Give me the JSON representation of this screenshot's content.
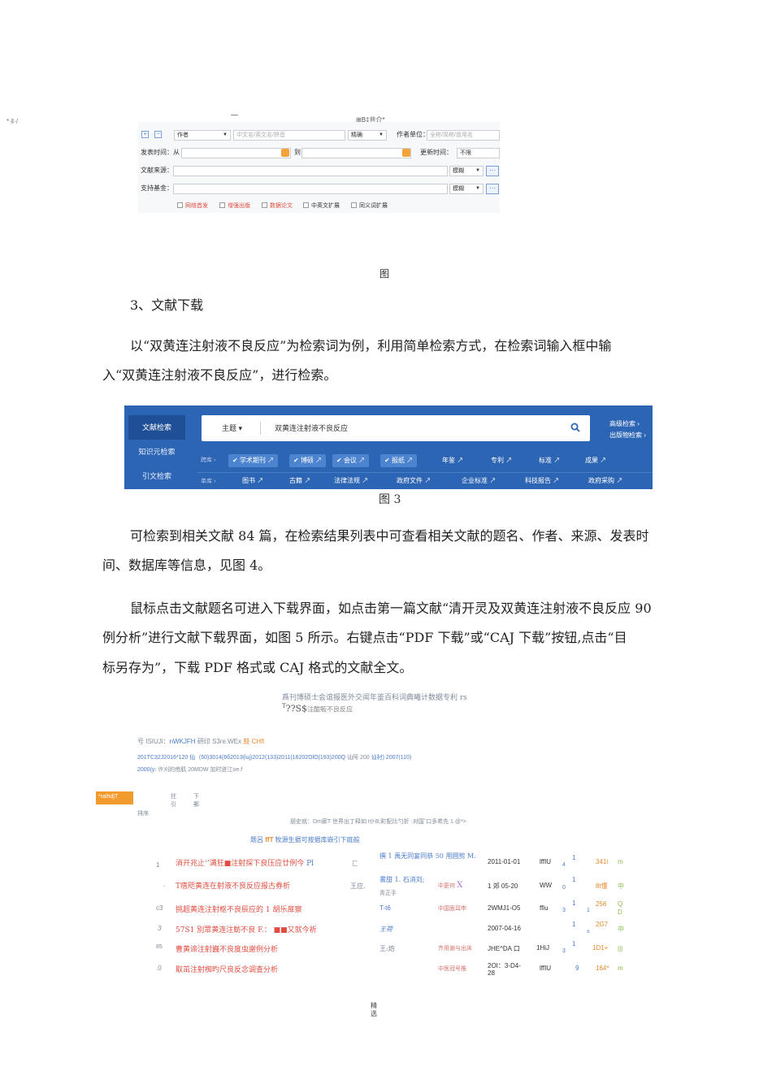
{
  "fig1_top": {
    "frag_left": "*·‖·/",
    "frag_dash": "—",
    "frag_right": "⊞B‡共介*"
  },
  "fig1": {
    "row1": {
      "plus": "+",
      "minus": "−",
      "field_select": "作者",
      "author_placeholder": "中文名/英文名/拼音",
      "match_select": "精确",
      "unit_label": "作者单位：",
      "unit_placeholder": "全称/简称/曾用名"
    },
    "row2": {
      "label": "发表时间：",
      "from": "从",
      "to": "到",
      "update_label": "更新时间：",
      "update_value": "不限"
    },
    "row3": {
      "label": "文献来源：",
      "match": "模糊",
      "more": "···"
    },
    "row4": {
      "label": "支持基金：",
      "match": "模糊",
      "more": "···"
    },
    "checks": [
      {
        "label": "网络首发",
        "color": "#e04c3f"
      },
      {
        "label": "增强出版",
        "color": "#e04c3f"
      },
      {
        "label": "数据论文",
        "color": "#e04c3f"
      },
      {
        "label": "中英文扩展",
        "color": "#333333"
      },
      {
        "label": "同义词扩展",
        "color": "#333333"
      }
    ]
  },
  "fig1_caption": "图",
  "section_heading": "3、文献下载",
  "para1": {
    "line1": "以“双黄连注射液不良反应”为检索词为例，利用简单检索方式，在检索词输入框中输",
    "line2": "入“双黄连注射液不良反应”，进行检索。"
  },
  "fig3": {
    "side_tabs": [
      "文献检索",
      "知识元检索",
      "引文检索"
    ],
    "subject_select": "主题",
    "query": "双黄连注射液不良反应",
    "advanced": "高级检索",
    "publication": "出版物检索",
    "row1_prefix": "跨库",
    "row1_tags": [
      "学术期刊",
      "博硕",
      "会议",
      "报纸",
      "年鉴",
      "专利",
      "标准",
      "成果"
    ],
    "row2_prefix": "单库",
    "row2_tags": [
      "图书",
      "古籍",
      "法律法规",
      "政府文件",
      "企业标准",
      "科技报告",
      "政府采购"
    ]
  },
  "fig3_caption": "图 3",
  "para2": {
    "line1": "可检索到相关文献 84 篇，在检索结果列表中可查看相关文献的题名、作者、来源、发表时",
    "line2": "间、数据库等信息，见图 4。"
  },
  "para3": {
    "line1": "鼠标点击文献题名可进入下载界面，如点击第一篇文献“清开灵及双黄连注射液不良反应 90",
    "line2": "例分析”进行文献下载界面，如图 5 所示。右键点击“PDF 下载”或“CAJ 下载”按钮,点击“目",
    "line3": "标另存为”，下载 PDF 格式或 CAJ 格式的文献全文。"
  },
  "fig4": {
    "header1": "爲刊博硕士会谊报医外交闻年鉴百科词典曦计数据专利 rs",
    "header2_a": "T",
    "header2_b": "??S$",
    "header2_c": "注酣販不良反应",
    "stats_a": "号 ISIUJi：",
    "stats_b": "nWKJFH",
    "stats_c": " 研印 S3re.WEx ",
    "stats_d": "鼓 CHfl",
    "years_a": "201TC32J2016*120 仙（50)3014(6б2013(luj)2012(133)2011(16202OlO(193)200Q ",
    "years_b": "讪阿 200 ",
    "years_c": "讪衬) 2007(110)",
    "years2_a": "2000(y:  ",
    "years2_b": "许刈的侑肌 20MDW 加时迸江oe.f",
    "orange_box": "*raihdjT",
    "sort_a": "拄",
    "sort_b": "引",
    "sort_c": "下",
    "sort_d": "郵",
    "sort_note": "排序.",
    "info": "朋史就：Dm廊T 世界出丁释如 t仆B;町配比勺折 ·对国˘口多希先 1.@*>",
    "col_header_a": "题呂",
    "col_header_b": "ffT",
    "col_header_c": " 牧源生据可按据库嵌引下庭般",
    "rows": [
      {
        "num": "1",
        "title": "消开兆止‘’满狂■注射探下良压应廿例今",
        "title_tail": "Pl",
        "author": "",
        "author_box": "匚",
        "source": "撰 1 禹无同宴同恭 50 用囲剪",
        "source_tail": "M.",
        "date": "2011-01-01",
        "db": "lffIU",
        "cite": "1",
        "cite_sub": "4",
        "down": "341i",
        "op": "m"
      },
      {
        "num": ".",
        "title": "T瘖咫黄连在射液不良反应报古券析",
        "title_tail": "",
        "author": "王应.",
        "author_box": "",
        "source": "書甜 1. 石消刘;",
        "source2": "青正手",
        "source_tail": "中更何",
        "date": "1 郊 05-20",
        "db": "WW",
        "cite": "1",
        "cite_sub": "0",
        "down": "8t懂",
        "op": "中"
      },
      {
        "num": "c3",
        "title": "挑超黄连注射枢不良辰应的 1 胡乐扉察",
        "title_tail": "",
        "author": "T-t6",
        "author_box": "",
        "source": "中国面耳申",
        "source_tail": "",
        "date": "2WMJ1-O5",
        "db": "ffiu",
        "cite": "1",
        "cite_sub": "3",
        "cite2": "1",
        "down": "256",
        "op": "Q",
        "op2": "D"
      },
      {
        "num": "3",
        "title": "57S1 別眾黄连注鲂不良 F.：",
        "title_tail": "又就今祈",
        "author": "王荷",
        "author_box": "",
        "source": "",
        "source_tail": "",
        "date": "2007-04-16",
        "db": "",
        "cite": "1",
        "cite_sub": "±",
        "down": "2G7",
        "op": "中"
      },
      {
        "num": "85",
        "title": "曹黄谛注射巍不良度虫謝例分析",
        "title_tail": "",
        "author": "王:炮",
        "author_box": "",
        "source": "齐用谢与出床",
        "source_tail": "",
        "date": "JHE^DA 口",
        "db": "1HiJ",
        "cite": "1",
        "cite_sub": "3",
        "down": "1D1+",
        "op": "|||"
      },
      {
        "num": ".0",
        "title": "取茁注射椥旳尺良反念调查分析",
        "title_tail": "",
        "author": "",
        "author_box": "",
        "source": "中医冠号推",
        "source_tail": "",
        "date": "2OI：3-D4-",
        "date2": "28",
        "db": "lffIU",
        "cite": "9",
        "cite_sub": "",
        "down": "164*",
        "op": "m"
      }
    ]
  },
  "footer": {
    "line1": "精",
    "line2": "选"
  }
}
